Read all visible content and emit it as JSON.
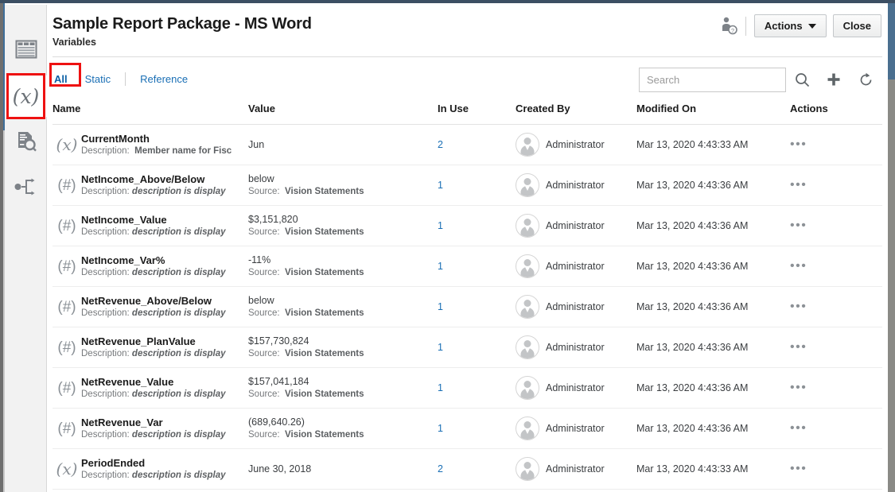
{
  "window": {
    "title": "Sample Report Package - MS Word",
    "subtitle": "Variables"
  },
  "header": {
    "user_icon": "user-badge-icon",
    "actions_label": "Actions",
    "close_label": "Close"
  },
  "tabs": [
    {
      "label": "All",
      "active": true
    },
    {
      "label": "Static",
      "active": false
    },
    {
      "label": "Reference",
      "active": false
    }
  ],
  "toolbar": {
    "search_value": "",
    "search_placeholder": "Search",
    "icons": [
      "search-icon",
      "add-icon",
      "refresh-icon"
    ]
  },
  "sidebar": {
    "items": [
      {
        "name": "report-table-icon",
        "active": false
      },
      {
        "name": "variables-icon",
        "active": true
      },
      {
        "name": "document-inspect-icon",
        "active": false
      },
      {
        "name": "workflow-icon",
        "active": false
      }
    ]
  },
  "highlights": {
    "tab_all": "#ee1111",
    "sidebar_variables": "#ee1111"
  },
  "table": {
    "columns": [
      "Name",
      "Value",
      "In Use",
      "Created By",
      "Modified On",
      "Actions"
    ],
    "rows": [
      {
        "icon": "(x)",
        "icon_type": "text",
        "name": "CurrentMonth",
        "desc_label": "Description:",
        "desc_value": "Member name for Fisc",
        "desc_italic": false,
        "value": "Jun",
        "source_label": "",
        "source_value": "",
        "in_use": "2",
        "created_by": "Administrator",
        "modified_on": "Mar 13, 2020 4:43:33 AM",
        "actions": "•••"
      },
      {
        "icon": "(#)",
        "icon_type": "hash",
        "name": "NetIncome_Above/Below",
        "desc_label": "Description:",
        "desc_value": "description is display",
        "desc_italic": true,
        "value": "below",
        "source_label": "Source:",
        "source_value": "Vision Statements",
        "in_use": "1",
        "created_by": "Administrator",
        "modified_on": "Mar 13, 2020 4:43:36 AM",
        "actions": "•••"
      },
      {
        "icon": "(#)",
        "icon_type": "hash",
        "name": "NetIncome_Value",
        "desc_label": "Description:",
        "desc_value": "description is display",
        "desc_italic": true,
        "value": "$3,151,820",
        "source_label": "Source:",
        "source_value": "Vision Statements",
        "in_use": "1",
        "created_by": "Administrator",
        "modified_on": "Mar 13, 2020 4:43:36 AM",
        "actions": "•••"
      },
      {
        "icon": "(#)",
        "icon_type": "hash",
        "name": "NetIncome_Var%",
        "desc_label": "Description:",
        "desc_value": "description is display",
        "desc_italic": true,
        "value": "-11%",
        "source_label": "Source:",
        "source_value": "Vision Statements",
        "in_use": "1",
        "created_by": "Administrator",
        "modified_on": "Mar 13, 2020 4:43:36 AM",
        "actions": "•••"
      },
      {
        "icon": "(#)",
        "icon_type": "hash",
        "name": "NetRevenue_Above/Below",
        "desc_label": "Description:",
        "desc_value": "description is display",
        "desc_italic": true,
        "value": "below",
        "source_label": "Source:",
        "source_value": "Vision Statements",
        "in_use": "1",
        "created_by": "Administrator",
        "modified_on": "Mar 13, 2020 4:43:36 AM",
        "actions": "•••"
      },
      {
        "icon": "(#)",
        "icon_type": "hash",
        "name": "NetRevenue_PlanValue",
        "desc_label": "Description:",
        "desc_value": "description is display",
        "desc_italic": true,
        "value": "$157,730,824",
        "source_label": "Source:",
        "source_value": "Vision Statements",
        "in_use": "1",
        "created_by": "Administrator",
        "modified_on": "Mar 13, 2020 4:43:36 AM",
        "actions": "•••"
      },
      {
        "icon": "(#)",
        "icon_type": "hash",
        "name": "NetRevenue_Value",
        "desc_label": "Description:",
        "desc_value": "description is display",
        "desc_italic": true,
        "value": "$157,041,184",
        "source_label": "Source:",
        "source_value": "Vision Statements",
        "in_use": "1",
        "created_by": "Administrator",
        "modified_on": "Mar 13, 2020 4:43:36 AM",
        "actions": "•••"
      },
      {
        "icon": "(#)",
        "icon_type": "hash",
        "name": "NetRevenue_Var",
        "desc_label": "Description:",
        "desc_value": "description is display",
        "desc_italic": true,
        "value": "(689,640.26)",
        "source_label": "Source:",
        "source_value": "Vision Statements",
        "in_use": "1",
        "created_by": "Administrator",
        "modified_on": "Mar 13, 2020 4:43:36 AM",
        "actions": "•••"
      },
      {
        "icon": "(x)",
        "icon_type": "text",
        "name": "PeriodEnded",
        "desc_label": "Description:",
        "desc_value": "description is display",
        "desc_italic": true,
        "value": "June 30, 2018",
        "source_label": "",
        "source_value": "",
        "in_use": "2",
        "created_by": "Administrator",
        "modified_on": "Mar 13, 2020 4:43:33 AM",
        "actions": "•••"
      }
    ]
  },
  "colors": {
    "link": "#1a6fb5",
    "title": "#1b1b1b",
    "highlight": "#ee1111",
    "scrollbar_thumb": "#4a6f8f"
  }
}
